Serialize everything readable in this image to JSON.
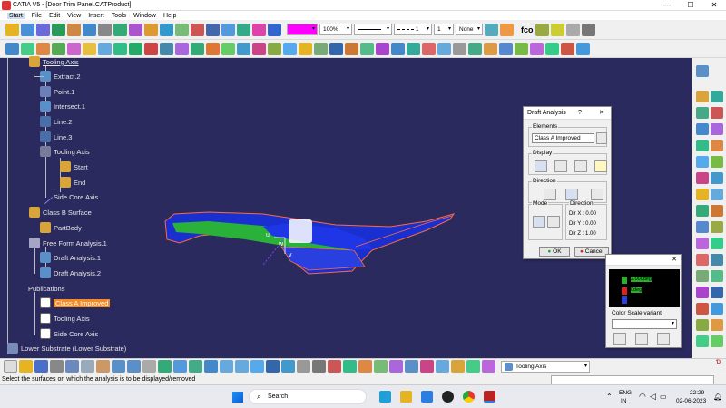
{
  "window": {
    "title": "CATIA V5 - [Door Trim Panel.CATProduct]",
    "min": "—",
    "max": "☐",
    "close": "✕"
  },
  "menu": [
    "Start",
    "File",
    "Edit",
    "View",
    "Insert",
    "Tools",
    "Window",
    "Help"
  ],
  "toolbar": {
    "color_value": "",
    "transparency": "100%",
    "linetype": "",
    "thickness": "1",
    "layer_value": "1",
    "layer_none": "None",
    "fog_label": "fco"
  },
  "tree": [
    {
      "label": "Tooling Axis"
    },
    {
      "label": "Extract.2"
    },
    {
      "label": "Point.1"
    },
    {
      "label": "Intersect.1"
    },
    {
      "label": "Line.2"
    },
    {
      "label": "Line.3"
    },
    {
      "label": "Tooling Axis"
    },
    {
      "label": "Start"
    },
    {
      "label": "End"
    },
    {
      "label": "Side Core Axis"
    },
    {
      "label": "Class B Surface"
    },
    {
      "label": "PartBody"
    },
    {
      "label": "Free Form Analysis.1"
    },
    {
      "label": "Draft Analysis.1"
    },
    {
      "label": "Draft Analysis.2"
    },
    {
      "label": "Publications"
    },
    {
      "label": "Class A Improved"
    },
    {
      "label": "Tooling Axis"
    },
    {
      "label": "Side Core Axis"
    },
    {
      "label": "Lower Substrate (Lower Substrate)"
    }
  ],
  "compass": {
    "u": "u",
    "w": "w",
    "v": "v"
  },
  "draft_dialog": {
    "title": "Draft Analysis",
    "help": "?",
    "close": "✕",
    "elements_label": "Elements",
    "elements_value": "Class A Improved",
    "display_label": "Display",
    "direction_label": "Direction",
    "mode_label": "Mode",
    "direction2_label": "Direction",
    "dirx": "Dir X :  0.00",
    "diry": "Dir Y :  0.00",
    "dirz": "Dir Z :  1.00",
    "ok": "OK",
    "cancel": "Cancel"
  },
  "color_scale": {
    "close": "✕",
    "label1": "2.000deg",
    "label2": "0deg",
    "variant_label": "Color Scale variant",
    "variant_value": ""
  },
  "status": {
    "current_selection": "Tooling Axis",
    "message": "Select the surfaces on which the analysis is to be displayed/removed"
  },
  "taskbar": {
    "search": "Search",
    "lang1": "ENG",
    "lang2": "IN",
    "time": "22:29",
    "date": "02-06-2023"
  },
  "colors": {
    "viewport_bg": "#2b2a5e",
    "selection": "#f28c28",
    "tree_text": "#e8e8e8"
  }
}
